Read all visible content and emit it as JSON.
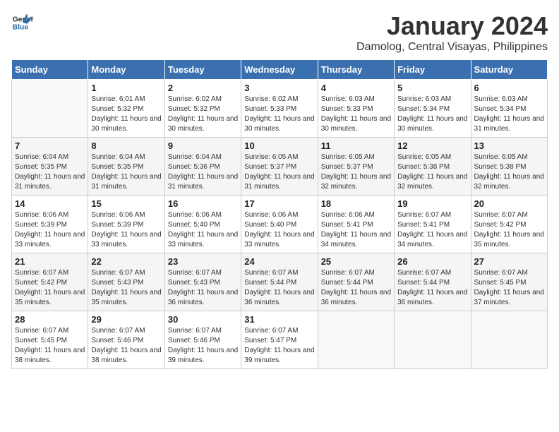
{
  "header": {
    "logo_general": "General",
    "logo_blue": "Blue",
    "month_title": "January 2024",
    "location": "Damolog, Central Visayas, Philippines"
  },
  "days_of_week": [
    "Sunday",
    "Monday",
    "Tuesday",
    "Wednesday",
    "Thursday",
    "Friday",
    "Saturday"
  ],
  "weeks": [
    [
      {
        "day": "",
        "sunrise": "",
        "sunset": "",
        "daylight": ""
      },
      {
        "day": "1",
        "sunrise": "6:01 AM",
        "sunset": "5:32 PM",
        "daylight": "11 hours and 30 minutes."
      },
      {
        "day": "2",
        "sunrise": "6:02 AM",
        "sunset": "5:32 PM",
        "daylight": "11 hours and 30 minutes."
      },
      {
        "day": "3",
        "sunrise": "6:02 AM",
        "sunset": "5:33 PM",
        "daylight": "11 hours and 30 minutes."
      },
      {
        "day": "4",
        "sunrise": "6:03 AM",
        "sunset": "5:33 PM",
        "daylight": "11 hours and 30 minutes."
      },
      {
        "day": "5",
        "sunrise": "6:03 AM",
        "sunset": "5:34 PM",
        "daylight": "11 hours and 30 minutes."
      },
      {
        "day": "6",
        "sunrise": "6:03 AM",
        "sunset": "5:34 PM",
        "daylight": "11 hours and 31 minutes."
      }
    ],
    [
      {
        "day": "7",
        "sunrise": "6:04 AM",
        "sunset": "5:35 PM",
        "daylight": "11 hours and 31 minutes."
      },
      {
        "day": "8",
        "sunrise": "6:04 AM",
        "sunset": "5:35 PM",
        "daylight": "11 hours and 31 minutes."
      },
      {
        "day": "9",
        "sunrise": "6:04 AM",
        "sunset": "5:36 PM",
        "daylight": "11 hours and 31 minutes."
      },
      {
        "day": "10",
        "sunrise": "6:05 AM",
        "sunset": "5:37 PM",
        "daylight": "11 hours and 31 minutes."
      },
      {
        "day": "11",
        "sunrise": "6:05 AM",
        "sunset": "5:37 PM",
        "daylight": "11 hours and 32 minutes."
      },
      {
        "day": "12",
        "sunrise": "6:05 AM",
        "sunset": "5:38 PM",
        "daylight": "11 hours and 32 minutes."
      },
      {
        "day": "13",
        "sunrise": "6:05 AM",
        "sunset": "5:38 PM",
        "daylight": "11 hours and 32 minutes."
      }
    ],
    [
      {
        "day": "14",
        "sunrise": "6:06 AM",
        "sunset": "5:39 PM",
        "daylight": "11 hours and 33 minutes."
      },
      {
        "day": "15",
        "sunrise": "6:06 AM",
        "sunset": "5:39 PM",
        "daylight": "11 hours and 33 minutes."
      },
      {
        "day": "16",
        "sunrise": "6:06 AM",
        "sunset": "5:40 PM",
        "daylight": "11 hours and 33 minutes."
      },
      {
        "day": "17",
        "sunrise": "6:06 AM",
        "sunset": "5:40 PM",
        "daylight": "11 hours and 33 minutes."
      },
      {
        "day": "18",
        "sunrise": "6:06 AM",
        "sunset": "5:41 PM",
        "daylight": "11 hours and 34 minutes."
      },
      {
        "day": "19",
        "sunrise": "6:07 AM",
        "sunset": "5:41 PM",
        "daylight": "11 hours and 34 minutes."
      },
      {
        "day": "20",
        "sunrise": "6:07 AM",
        "sunset": "5:42 PM",
        "daylight": "11 hours and 35 minutes."
      }
    ],
    [
      {
        "day": "21",
        "sunrise": "6:07 AM",
        "sunset": "5:42 PM",
        "daylight": "11 hours and 35 minutes."
      },
      {
        "day": "22",
        "sunrise": "6:07 AM",
        "sunset": "5:43 PM",
        "daylight": "11 hours and 35 minutes."
      },
      {
        "day": "23",
        "sunrise": "6:07 AM",
        "sunset": "5:43 PM",
        "daylight": "11 hours and 36 minutes."
      },
      {
        "day": "24",
        "sunrise": "6:07 AM",
        "sunset": "5:44 PM",
        "daylight": "11 hours and 36 minutes."
      },
      {
        "day": "25",
        "sunrise": "6:07 AM",
        "sunset": "5:44 PM",
        "daylight": "11 hours and 36 minutes."
      },
      {
        "day": "26",
        "sunrise": "6:07 AM",
        "sunset": "5:44 PM",
        "daylight": "11 hours and 36 minutes."
      },
      {
        "day": "27",
        "sunrise": "6:07 AM",
        "sunset": "5:45 PM",
        "daylight": "11 hours and 37 minutes."
      }
    ],
    [
      {
        "day": "28",
        "sunrise": "6:07 AM",
        "sunset": "5:45 PM",
        "daylight": "11 hours and 38 minutes."
      },
      {
        "day": "29",
        "sunrise": "6:07 AM",
        "sunset": "5:46 PM",
        "daylight": "11 hours and 38 minutes."
      },
      {
        "day": "30",
        "sunrise": "6:07 AM",
        "sunset": "5:46 PM",
        "daylight": "11 hours and 39 minutes."
      },
      {
        "day": "31",
        "sunrise": "6:07 AM",
        "sunset": "5:47 PM",
        "daylight": "11 hours and 39 minutes."
      },
      {
        "day": "",
        "sunrise": "",
        "sunset": "",
        "daylight": ""
      },
      {
        "day": "",
        "sunrise": "",
        "sunset": "",
        "daylight": ""
      },
      {
        "day": "",
        "sunrise": "",
        "sunset": "",
        "daylight": ""
      }
    ]
  ]
}
